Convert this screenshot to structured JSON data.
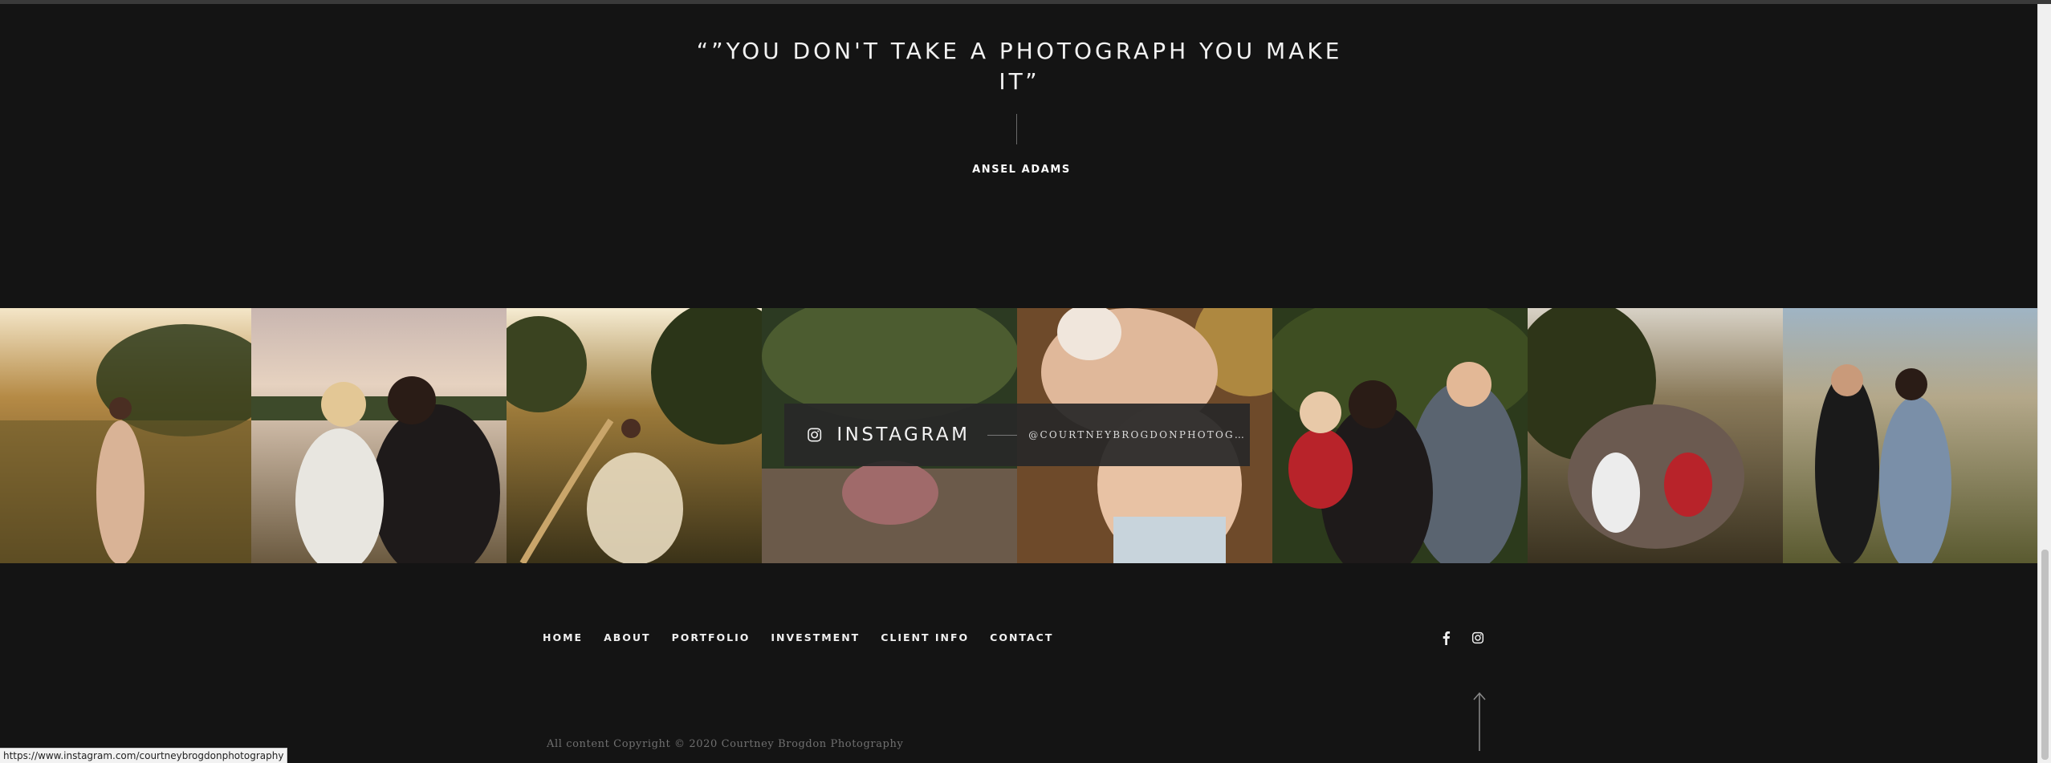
{
  "quote": {
    "text": "“”YOU DON'T TAKE A PHOTOGRAPH YOU MAKE IT”",
    "author": "ANSEL ADAMS"
  },
  "instagram": {
    "title": "INSTAGRAM",
    "handle": "@COURTNEYBROGDONPHOTOGRA…",
    "icon": "instagram-icon"
  },
  "footer": {
    "nav": [
      "HOME",
      "ABOUT",
      "PORTFOLIO",
      "INVESTMENT",
      "CLIENT INFO",
      "CONTACT"
    ],
    "social_icons": [
      "facebook-icon",
      "instagram-icon"
    ],
    "scroll_top_icon": "arrow-up-icon",
    "copyright": "All content Copyright © 2020 Courtney Brogdon Photography"
  },
  "status_bar": {
    "url": "https://www.instagram.com/courtneybrogdonphotography"
  },
  "colors": {
    "background": "#141414",
    "text": "#f0f0f0",
    "muted": "#707070",
    "overlay": "#282828"
  }
}
